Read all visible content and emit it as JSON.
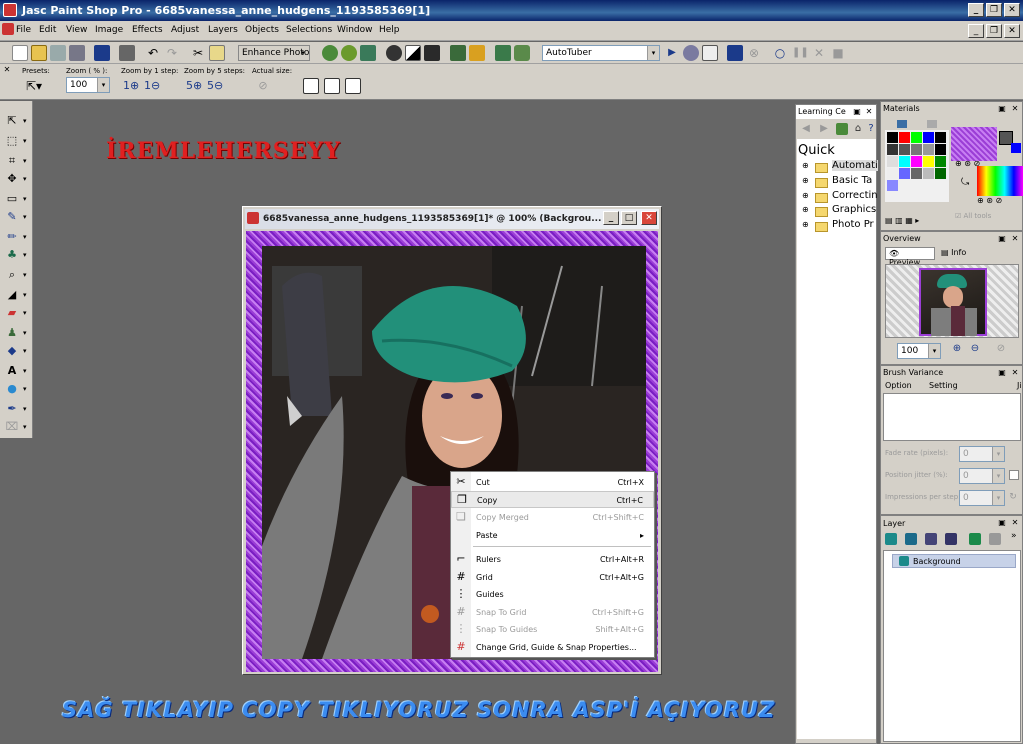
{
  "app": {
    "title": "Jasc Paint Shop Pro - 6685vanessa_anne_hudgens_1193585369[1]"
  },
  "menu": [
    "File",
    "Edit",
    "View",
    "Image",
    "Effects",
    "Adjust",
    "Layers",
    "Objects",
    "Selections",
    "Window",
    "Help"
  ],
  "toolbar": {
    "enhance_photo": "Enhance Photo",
    "script_select": "AutoTuber"
  },
  "tool_options": {
    "presets_label": "Presets:",
    "zoom_label": "Zoom ( % ):",
    "zoom_value": "100",
    "zoom1_label": "Zoom by 1 step:",
    "zoom5_label": "Zoom by 5 steps:",
    "actual_label": "Actual size:"
  },
  "overlay_text": {
    "top": "İREMLEHERSEYY",
    "bottom": "SAĞ TIKLAYIP COPY TIKLIYORUZ SONRA ASP'İ AÇIYORUZ"
  },
  "image_window": {
    "title": "6685vanessa_anne_hudgens_1193585369[1]* @ 100% (Backgrou..."
  },
  "context_menu": {
    "items": [
      {
        "label": "Cut",
        "shortcut": "Ctrl+X",
        "disabled": false
      },
      {
        "label": "Copy",
        "shortcut": "Ctrl+C",
        "disabled": false
      },
      {
        "label": "Copy Merged",
        "shortcut": "Ctrl+Shift+C",
        "disabled": true
      },
      {
        "label": "Paste",
        "shortcut": "",
        "disabled": false
      },
      {
        "label": "Rulers",
        "shortcut": "Ctrl+Alt+R",
        "disabled": false
      },
      {
        "label": "Grid",
        "shortcut": "Ctrl+Alt+G",
        "disabled": false
      },
      {
        "label": "Guides",
        "shortcut": "",
        "disabled": false
      },
      {
        "label": "Snap To Grid",
        "shortcut": "Ctrl+Shift+G",
        "disabled": true
      },
      {
        "label": "Snap To Guides",
        "shortcut": "Shift+Alt+G",
        "disabled": true
      },
      {
        "label": "Change Grid, Guide & Snap Properties...",
        "shortcut": "",
        "disabled": false
      }
    ]
  },
  "learning_center": {
    "title": "Learning Ce",
    "heading": "Quick",
    "items": [
      "Automati",
      "Basic Ta",
      "Correctin",
      "Graphics",
      "Photo Pr"
    ]
  },
  "materials": {
    "title": "Materials",
    "all_tools": "All tools"
  },
  "overview": {
    "title": "Overview",
    "tab_preview": "Preview",
    "tab_info": "Info",
    "zoom_value": "100"
  },
  "brush_variance": {
    "title": "Brush Variance",
    "col_option": "Option",
    "col_setting": "Setting",
    "col_j": "Ji",
    "fade_label": "Fade rate (pixels):",
    "position_label": "Position jitter (%):",
    "impressions_label": "Impressions per step:",
    "fade_value": "0",
    "position_value": "0",
    "impressions_value": "0"
  },
  "layer": {
    "title": "Layer",
    "name": "Background"
  }
}
